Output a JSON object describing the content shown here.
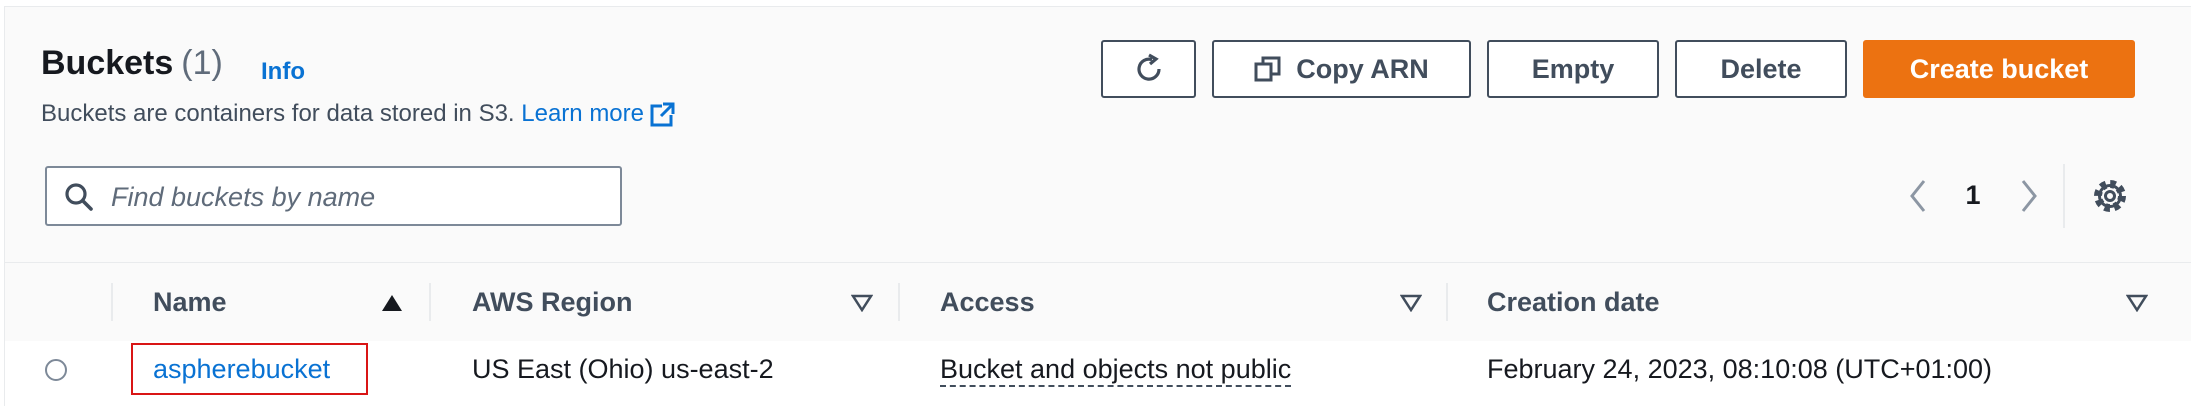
{
  "header": {
    "title": "Buckets",
    "count": "(1)",
    "info_label": "Info",
    "description": "Buckets are containers for data stored in S3.",
    "learn_more_label": "Learn more"
  },
  "actions": {
    "refresh_icon": "refresh-icon",
    "copy_arn_label": "Copy ARN",
    "empty_label": "Empty",
    "delete_label": "Delete",
    "create_label": "Create bucket"
  },
  "search": {
    "placeholder": "Find buckets by name",
    "value": ""
  },
  "pagination": {
    "current_page": "1"
  },
  "table": {
    "columns": [
      {
        "label": "Name",
        "sort": "ascending"
      },
      {
        "label": "AWS Region",
        "sort": "none"
      },
      {
        "label": "Access",
        "sort": "none"
      },
      {
        "label": "Creation date",
        "sort": "none"
      }
    ],
    "rows": [
      {
        "selected": false,
        "name": "aspherebucket",
        "region": "US East (Ohio) us-east-2",
        "access": "Bucket and objects not public",
        "creation_date": "February 24, 2023, 08:10:08 (UTC+01:00)"
      }
    ]
  },
  "colors": {
    "primary_button": "#ec7211",
    "link": "#0972d3",
    "highlight_box": "#d91515",
    "panel_background": "#fafafa"
  }
}
